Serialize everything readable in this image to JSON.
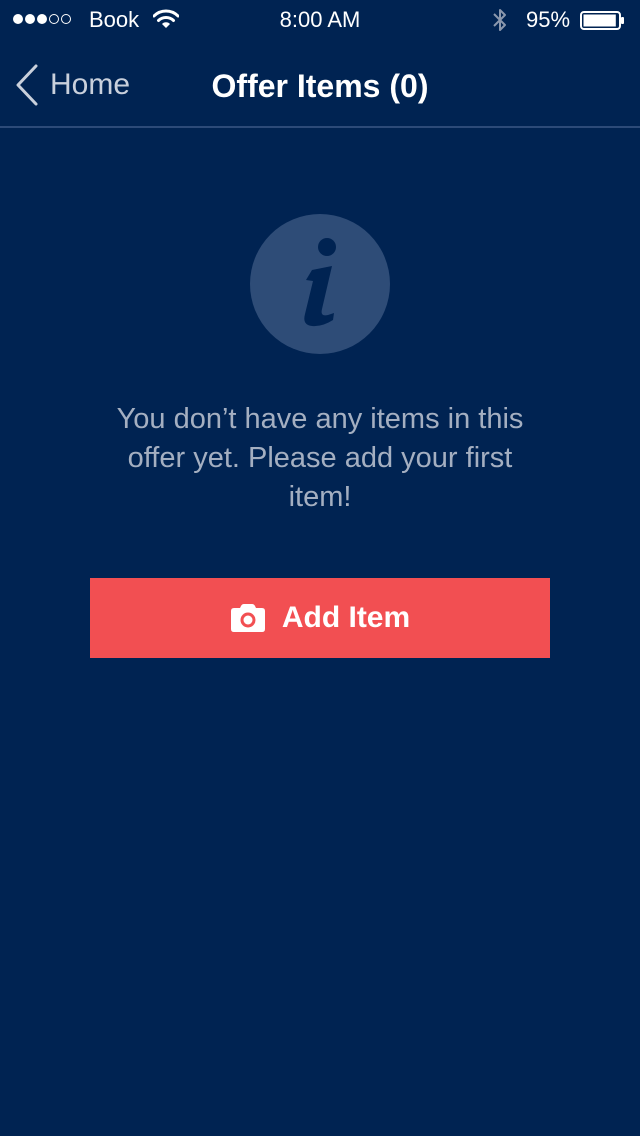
{
  "status_bar": {
    "carrier": "Book",
    "time": "8:00 AM",
    "battery_percent": "95%",
    "signal_strength": 3,
    "signal_total": 5,
    "battery_level": 0.95
  },
  "nav": {
    "back_label": "Home",
    "title": "Offer Items (0)"
  },
  "empty_state": {
    "message": "You don’t have any items in this offer yet. Please add your first item!",
    "icon": "info-icon"
  },
  "add_button": {
    "label": "Add Item",
    "icon": "camera-icon"
  },
  "colors": {
    "background": "#002352",
    "accent": "#f24f52",
    "info_circle": "#2e4c77",
    "message_text": "#a4afc1"
  }
}
